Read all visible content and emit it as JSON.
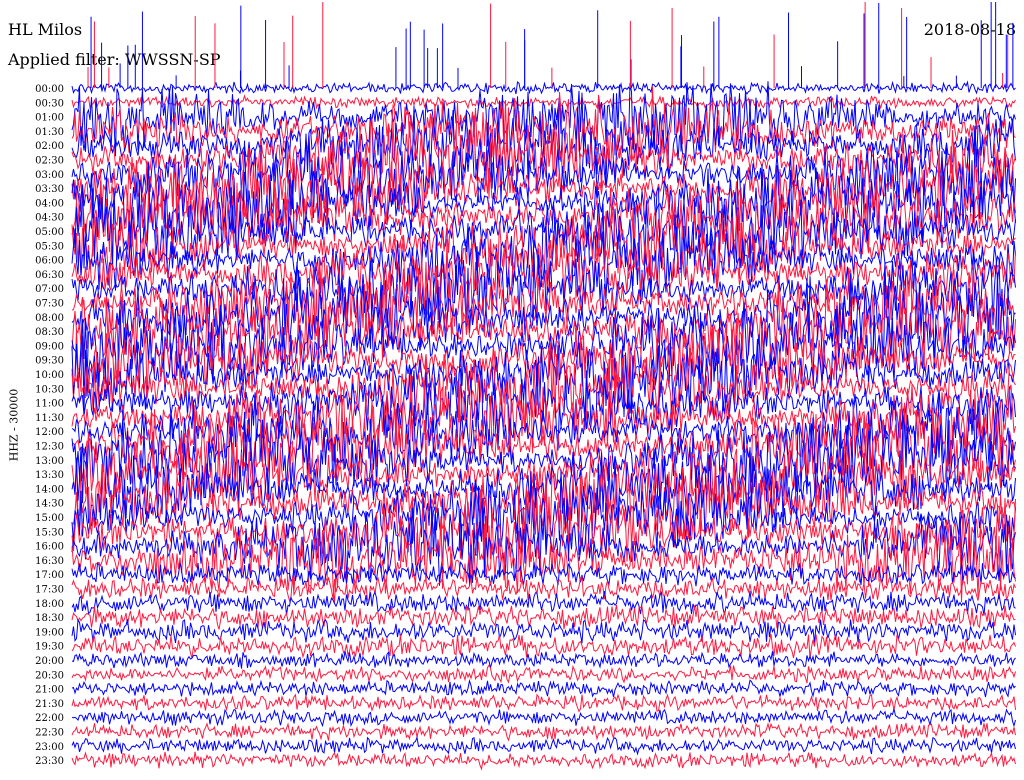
{
  "header": {
    "station": "HL Milos",
    "filter": "Applied filter: WWSSN-SP",
    "date": "2018-08-18"
  },
  "colors": {
    "trace_a": "#0000ff",
    "trace_b": "#ff1a40",
    "background": "#ffffff"
  },
  "chart_data": {
    "type": "line",
    "title": "HL Milos",
    "ylabel": "HHZ - 30000",
    "row_labels": [
      "00:00",
      "00:30",
      "01:00",
      "01:30",
      "02:00",
      "02:30",
      "03:00",
      "03:30",
      "04:00",
      "04:30",
      "05:00",
      "05:30",
      "06:00",
      "06:30",
      "07:00",
      "07:30",
      "08:00",
      "08:30",
      "09:00",
      "09:30",
      "10:00",
      "10:30",
      "11:00",
      "11:30",
      "12:00",
      "12:30",
      "13:00",
      "13:30",
      "14:00",
      "14:30",
      "15:00",
      "15:30",
      "16:00",
      "16:30",
      "17:00",
      "17:30",
      "18:00",
      "18:30",
      "19:00",
      "19:30",
      "20:00",
      "20:30",
      "21:00",
      "21:30",
      "22:00",
      "22:30",
      "23:00",
      "23:30"
    ],
    "series": [
      {
        "color": "#0000ff",
        "rows": "00:00,01:00,02:00,...,23:00"
      },
      {
        "color": "#ff1a40",
        "rows": "00:30,01:30,02:30,...,23:30"
      }
    ],
    "legend": "none",
    "grid": false
  }
}
